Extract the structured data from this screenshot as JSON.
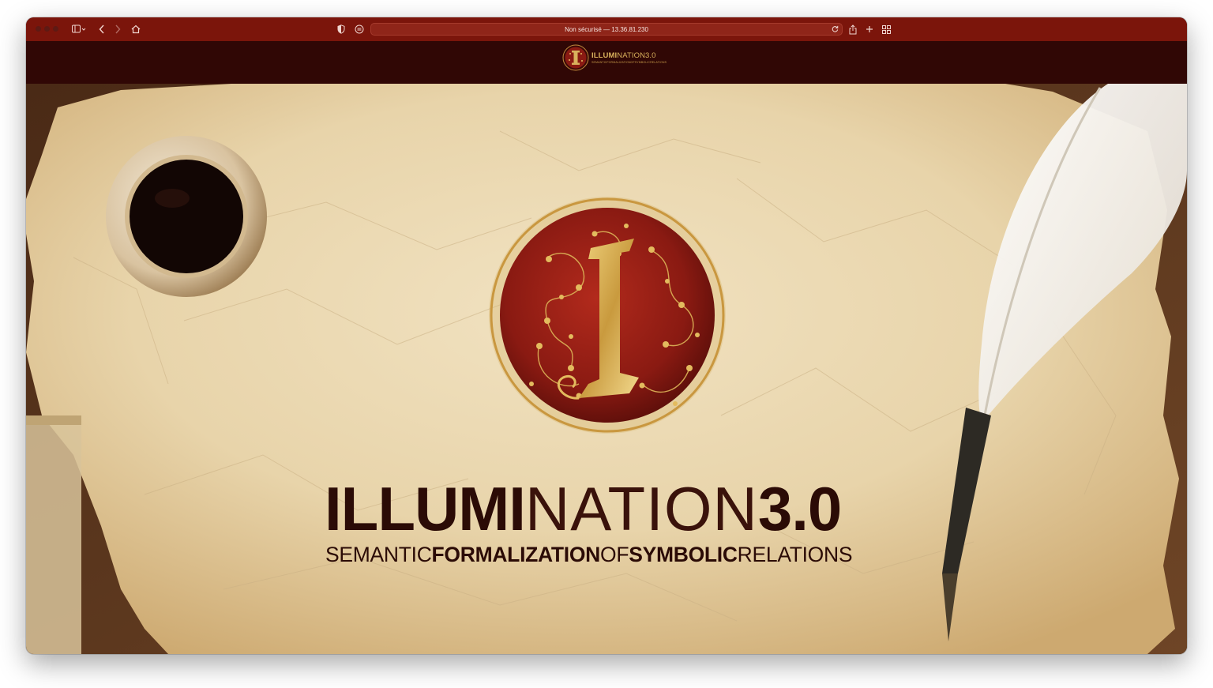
{
  "browser": {
    "address": "Non sécurisé — 13.36.81.230",
    "icons": {
      "sidebar": "sidebar-icon",
      "back": "chevron-left-icon",
      "forward": "chevron-right-icon",
      "home": "home-icon",
      "privacy": "shield-icon",
      "reader": "reader-icon",
      "reload": "reload-icon",
      "share": "share-icon",
      "new_tab": "plus-icon",
      "tab_overview": "grid-icon"
    },
    "colors": {
      "toolbar": "#7b150b",
      "header": "#300705"
    }
  },
  "header": {
    "logo_title_bold": "ILLUMI",
    "logo_title_thin": "NATION3.0",
    "logo_subtitle": "SEMANTICFORMALIZATIONOFSYMBOLICRELATIONS"
  },
  "hero": {
    "title_bold_1": "ILLUMI",
    "title_thin": "NATION",
    "title_bold_2": "3.0",
    "subtitle": {
      "p1": "SEMANTIC",
      "p2": "FORMALIZATION",
      "p3": "OF",
      "p4": "SYMBOLIC",
      "p5": "RELATIONS"
    },
    "colors": {
      "emblem_red": "#8a1a12",
      "gold": "#d4a84a",
      "ink": "#2b0b06"
    }
  }
}
